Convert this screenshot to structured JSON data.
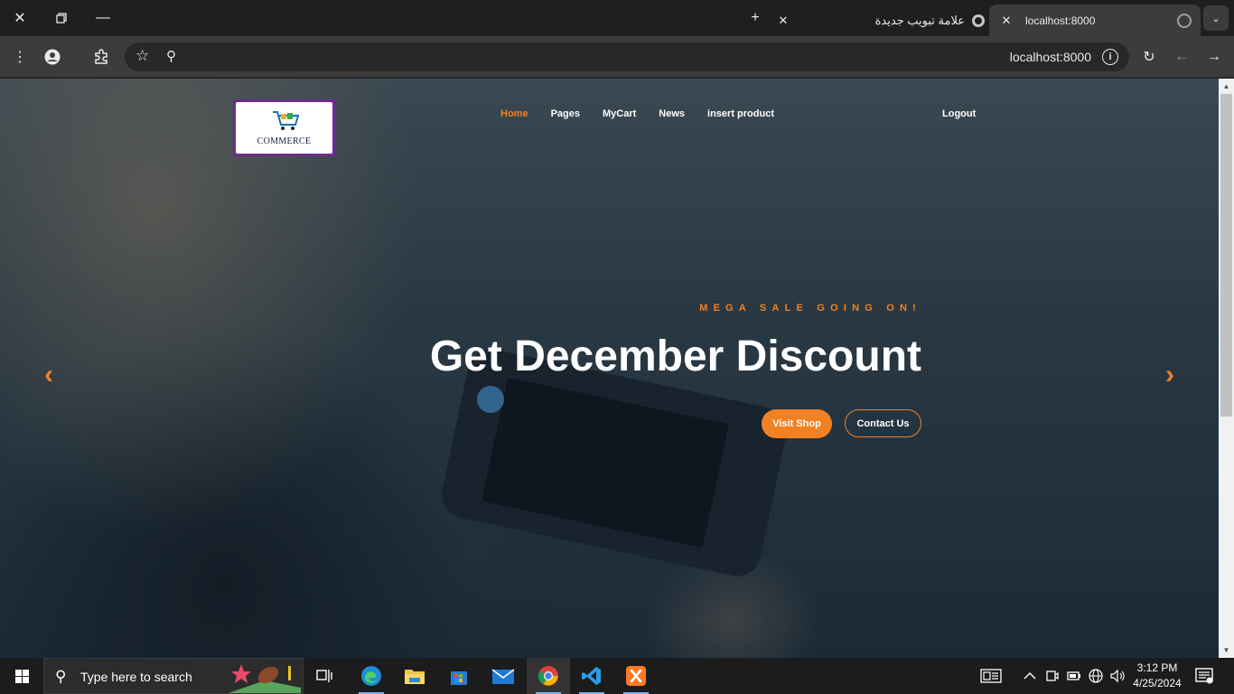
{
  "browser": {
    "tabs": [
      {
        "label": "localhost:8000",
        "active": true
      },
      {
        "label": "علامة تبويب جديدة",
        "active": false
      }
    ],
    "url": "localhost:8000"
  },
  "site": {
    "logo_text": "COMMERCE",
    "nav": [
      "Home",
      "Pages",
      "MyCart",
      "News",
      "insert product"
    ],
    "logout": "Logout",
    "hero": {
      "subtitle": "MEGA SALE GOING ON!",
      "title": "Get December Discount",
      "primary_button": "Visit Shop",
      "secondary_button": "Contact Us"
    },
    "colors": {
      "accent": "#f28123",
      "logo_border": "#6c2d8c"
    }
  },
  "taskbar": {
    "search_placeholder": "Type here to search",
    "time": "3:12 PM",
    "date": "4/25/2024",
    "apps": [
      "task-view",
      "edge",
      "file-explorer",
      "microsoft-store",
      "mail",
      "chrome",
      "vscode",
      "xampp"
    ]
  }
}
